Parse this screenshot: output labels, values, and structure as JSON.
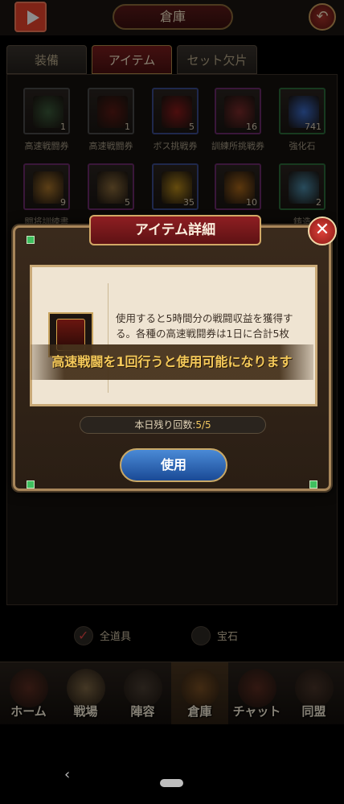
{
  "app": {
    "title": "倉庫",
    "back_glyph": "↶"
  },
  "tabs": [
    {
      "label": "装備",
      "active": false
    },
    {
      "label": "アイテム",
      "active": true
    },
    {
      "label": "セット欠片",
      "active": false
    }
  ],
  "inventory": {
    "items": [
      {
        "name": "高速戦闘券",
        "count": "1",
        "icon": "ticket-icon",
        "color": "#3a5a3a",
        "border": "#4a4a4a"
      },
      {
        "name": "高速戦闘券",
        "count": "1",
        "icon": "ticket-icon",
        "color": "#5a1a14",
        "border": "#4a4a4a"
      },
      {
        "name": "ボス挑戦券",
        "count": "5",
        "icon": "boss-ticket-icon",
        "color": "#8a1a1a",
        "border": "#3a4a8a"
      },
      {
        "name": "訓練所挑戦券",
        "count": "16",
        "icon": "training-ticket-icon",
        "color": "#7a2a2a",
        "border": "#6a2a6a"
      },
      {
        "name": "強化石",
        "count": "741",
        "icon": "crystal-icon",
        "color": "#3a6ac8",
        "border": "#2a6a3a"
      },
      {
        "name": "闘将訓練書",
        "count": "9",
        "icon": "book-icon",
        "color": "#a8742a",
        "border": "#6a2a6a"
      },
      {
        "name": "",
        "count": "5",
        "icon": "book-icon",
        "color": "#8a6a3a",
        "border": "#6a2a6a"
      },
      {
        "name": "",
        "count": "35",
        "icon": "gold-icon",
        "color": "#b88a1a",
        "border": "#3a4a8a"
      },
      {
        "name": "",
        "count": "10",
        "icon": "helmet-icon",
        "color": "#a8661a",
        "border": "#6a2a6a"
      },
      {
        "name": "鋳造",
        "count": "2",
        "icon": "ore-icon",
        "color": "#4a8aa8",
        "border": "#2a6a3a"
      }
    ]
  },
  "dialog": {
    "header": "アイテム詳細",
    "description": "使用すると5時間分の戦闘収益を獲得する。各種の高速戦闘券は1日に合計5枚",
    "remaining_label": "本日残り回数:",
    "remaining_value": "5/5",
    "use_button": "使用",
    "item_icon": "high-speed-ticket-icon",
    "close_glyph": "✕"
  },
  "toast": {
    "message": "高速戦闘を1回行うと使用可能になります"
  },
  "filters": [
    {
      "label": "全道具",
      "checked": true
    },
    {
      "label": "宝石",
      "checked": false
    }
  ],
  "bottom_nav": [
    {
      "label": "ホーム",
      "icon": "home-icon",
      "color": "#8a3a2a",
      "active": false
    },
    {
      "label": "戦場",
      "icon": "battlefield-icon",
      "color": "#c8a46a",
      "active": false
    },
    {
      "label": "陣容",
      "icon": "formation-icon",
      "color": "#6a5a4a",
      "active": false
    },
    {
      "label": "倉庫",
      "icon": "warehouse-icon",
      "color": "#a86a2a",
      "active": true
    },
    {
      "label": "チャット",
      "icon": "chat-icon",
      "color": "#8a3a2a",
      "active": false
    },
    {
      "label": "同盟",
      "icon": "alliance-icon",
      "color": "#6a4a3a",
      "active": false
    }
  ],
  "system_nav": {
    "back_glyph": "‹"
  },
  "colors": {
    "accent_red": "#8e1e22",
    "gold_border": "#c9a866",
    "toast_text": "#f4c95a",
    "use_button": "#1a4a96",
    "close_red": "#e0423a"
  }
}
